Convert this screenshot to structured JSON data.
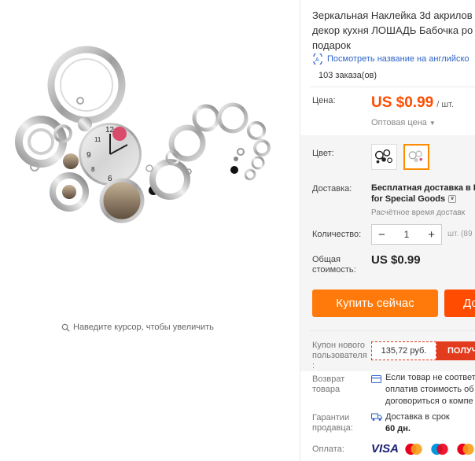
{
  "gallery": {
    "zoom_hint": "Наведите курсор, чтобы увеличить"
  },
  "product": {
    "title_lines": [
      "Зеркальная Наклейка 3d акрилов",
      "декор кухня ЛОШАДЬ Бабочка ро",
      "подарок"
    ],
    "translate_link": "Посмотреть название на английско",
    "orders": "103 заказа(ов)"
  },
  "price": {
    "label": "Цена:",
    "value": "US $0.99",
    "unit": "/ шт.",
    "wholesale": "Оптовая цена",
    "accent_color": "#ff4c00"
  },
  "color": {
    "label": "Цвет:"
  },
  "shipping": {
    "label": "Доставка:",
    "title": "Бесплатная доставка в R",
    "subtitle": "for Special Goods",
    "estimate": "Расчётное время доставк"
  },
  "quantity": {
    "label": "Количество:",
    "value": "1",
    "minus": "−",
    "plus": "+",
    "unit": "шт. (89"
  },
  "total": {
    "label_line1": "Общая",
    "label_line2": "стоимость:",
    "value": "US $0.99"
  },
  "actions": {
    "buy_now": "Купить сейчас",
    "add_to_cart": "До",
    "buy_color": "#ff7a0a",
    "cart_color": "#ff4c00"
  },
  "coupon": {
    "label_line1": "Купон нового",
    "label_line2": "пользователя",
    "label_line3": ":",
    "amount": "135,72 руб.",
    "get": "ПОЛУЧ"
  },
  "returns": {
    "label_line1": "Возврат",
    "label_line2": "товара",
    "text_line1": "Если товар не соответ",
    "text_line2": "оплатив стоимость об",
    "text_line3": "договориться о компе"
  },
  "guarantee": {
    "label_line1": "Гарантии",
    "label_line2": "продавца:",
    "text": "Доставка в срок",
    "days": "60 дн."
  },
  "payment": {
    "label": "Оплата:",
    "visa": "VISA"
  }
}
